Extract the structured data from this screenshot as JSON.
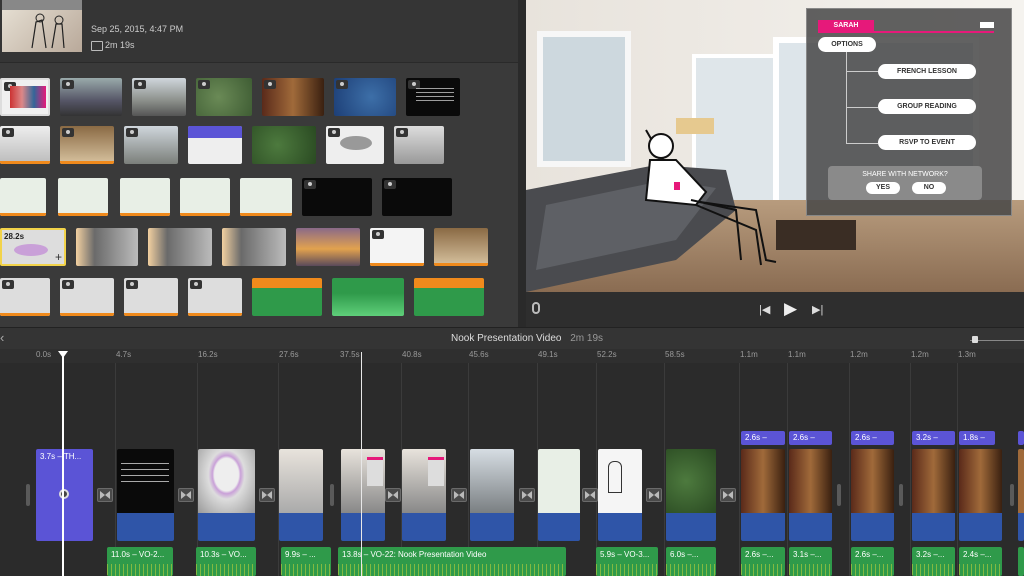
{
  "project": {
    "date": "Sep 25, 2015, 4:47 PM",
    "duration": "2m 19s",
    "thumb_duration": "28.2s"
  },
  "viewer": {
    "overlay": {
      "user": "SARAH",
      "options_label": "OPTIONS",
      "items": [
        "FRENCH LESSON",
        "GROUP READING",
        "RSVP TO EVENT"
      ],
      "question": "SHARE WITH NETWORK?",
      "yes": "YES",
      "no": "NO"
    }
  },
  "timeline": {
    "title": "Nook Presentation Video",
    "duration": "2m 19s",
    "ruler": [
      "0.0s",
      "4.7s",
      "16.2s",
      "27.6s",
      "37.5s",
      "40.8s",
      "45.6s",
      "49.1s",
      "52.2s",
      "58.5s",
      "1.1m",
      "1.1m",
      "1.2m",
      "1.2m",
      "1.3m"
    ],
    "title_clip": "3.7s – TH...",
    "badges": [
      "2.6s –",
      "2.6s –",
      "2.6s –",
      "3.2s –",
      "1.8s –"
    ],
    "vo_clips": [
      "11.0s – VO-2...",
      "10.3s – VO...",
      "9.9s – ...",
      "13.8s – VO-22: Nook Presentation Video",
      "5.9s – VO-3...",
      "6.0s –...",
      "2.6s –...",
      "3.1s –...",
      "2.6s –...",
      "3.2s –...",
      "2.4s –..."
    ]
  },
  "colors": {
    "accent_pink": "#e6197a",
    "title_clip": "#5b54d6",
    "audio_green": "#2f9a4a",
    "video_blue": "#2f55a8"
  }
}
